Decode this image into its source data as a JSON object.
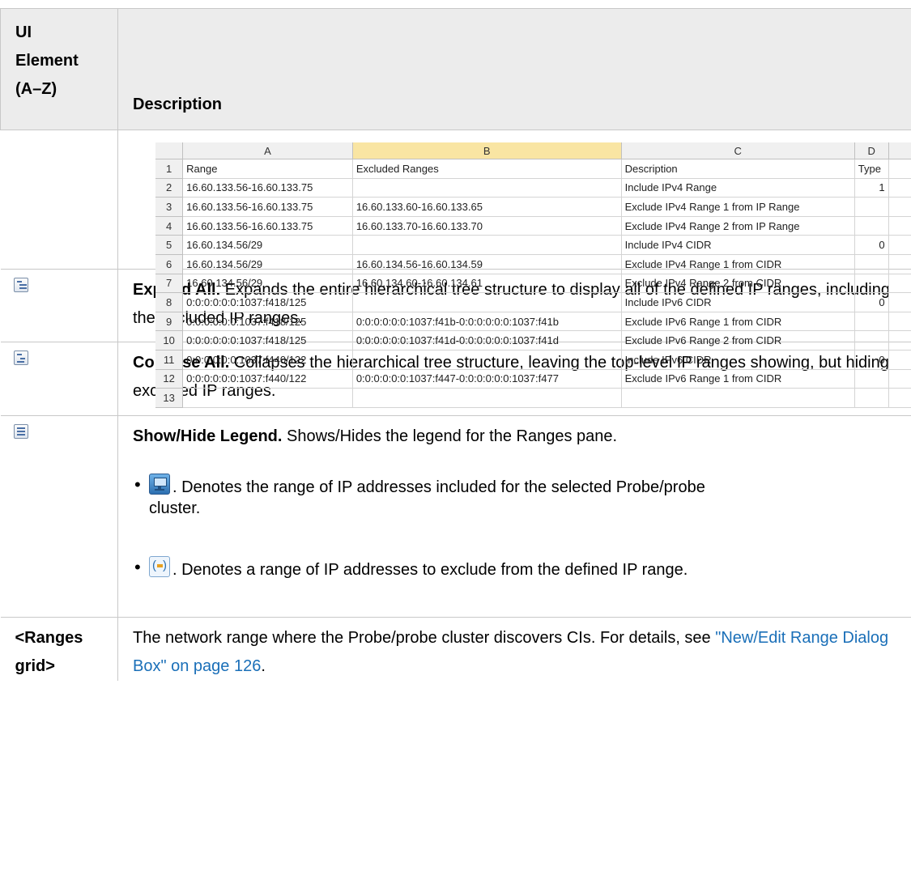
{
  "header": {
    "col1": [
      "UI",
      "Element",
      "(A–Z)"
    ],
    "col2": "Description"
  },
  "spreadsheet": {
    "columns": [
      "A",
      "B",
      "C",
      "D"
    ],
    "rows": [
      {
        "num": "1",
        "a": "Range",
        "b": "Excluded Ranges",
        "c": "Description",
        "d": "Type"
      },
      {
        "num": "2",
        "a": "16.60.133.56-16.60.133.75",
        "b": "",
        "c": "Include IPv4 Range",
        "d": "1"
      },
      {
        "num": "3",
        "a": "16.60.133.56-16.60.133.75",
        "b": "16.60.133.60-16.60.133.65",
        "c": "Exclude IPv4 Range 1 from IP Range",
        "d": ""
      },
      {
        "num": "4",
        "a": "16.60.133.56-16.60.133.75",
        "b": "16.60.133.70-16.60.133.70",
        "c": "Exclude IPv4 Range 2 from IP Range",
        "d": ""
      },
      {
        "num": "5",
        "a": "16.60.134.56/29",
        "b": "",
        "c": "Include IPv4 CIDR",
        "d": "0"
      },
      {
        "num": "6",
        "a": "16.60.134.56/29",
        "b": "16.60.134.56-16.60.134.59",
        "c": "Exclude IPv4 Range 1 from CIDR",
        "d": ""
      },
      {
        "num": "7",
        "a": "16.60.134.56/29",
        "b": "16.60.134.60-16.60.134.61",
        "c": "Exclude IPv4 Range 2 from CIDR",
        "d": ""
      },
      {
        "num": "8",
        "a": "0:0:0:0:0:0:1037:f418/125",
        "b": "",
        "c": "Include IPv6 CIDR",
        "d": "0"
      },
      {
        "num": "9",
        "a": "0:0:0:0:0:0:1037:f418/125",
        "b": "0:0:0:0:0:0:1037:f41b-0:0:0:0:0:0:1037:f41b",
        "c": "Exclude IPv6 Range 1 from CIDR",
        "d": ""
      },
      {
        "num": "10",
        "a": "0:0:0:0:0:0:1037:f418/125",
        "b": "0:0:0:0:0:0:1037:f41d-0:0:0:0:0:0:1037:f41d",
        "c": "Exclude IPv6 Range 2 from CIDR",
        "d": ""
      },
      {
        "num": "11",
        "a": "0:0:0:0:0:0:1037:f440/122",
        "b": "",
        "c": "Include IPv6 CIDR",
        "d": "0"
      },
      {
        "num": "12",
        "a": "0:0:0:0:0:0:1037:f440/122",
        "b": "0:0:0:0:0:0:1037:f447-0:0:0:0:0:0:1037:f477",
        "c": "Exclude IPv6 Range 1 from CIDR",
        "d": ""
      },
      {
        "num": "13",
        "a": "",
        "b": "",
        "c": "",
        "d": ""
      }
    ]
  },
  "expand_all": {
    "icon": "expand-all-icon",
    "title": "Expand All.",
    "text": " Expands the entire hierarchical tree structure to display all of the defined IP ranges, including the excluded IP ranges."
  },
  "collapse_all": {
    "icon": "collapse-all-icon",
    "title": "Collapse All.",
    "text": " Collapses the hierarchical tree structure, leaving the top-level IP ranges showing, but hiding excluded IP ranges."
  },
  "legend": {
    "icon": "legend-icon",
    "title": "Show/Hide Legend.",
    "text": " Shows/Hides the legend for the Ranges pane.",
    "items": [
      {
        "icon": "include-range-icon",
        "text": ". Denotes the range of IP addresses included for the selected Probe/probe cluster."
      },
      {
        "icon": "exclude-range-icon",
        "text": ". Denotes a range of IP addresses to exclude from the defined IP range."
      }
    ]
  },
  "ranges_grid": {
    "label": "<Ranges grid>",
    "text": "The network range where the Probe/probe cluster discovers CIs. For details, see ",
    "link": "\"New/Edit Range Dialog Box\" on page 126",
    "after": "."
  },
  "colors": {
    "link": "#1a6fb8",
    "header_bg": "#ececec",
    "selected_column": "#f9e5a3"
  }
}
